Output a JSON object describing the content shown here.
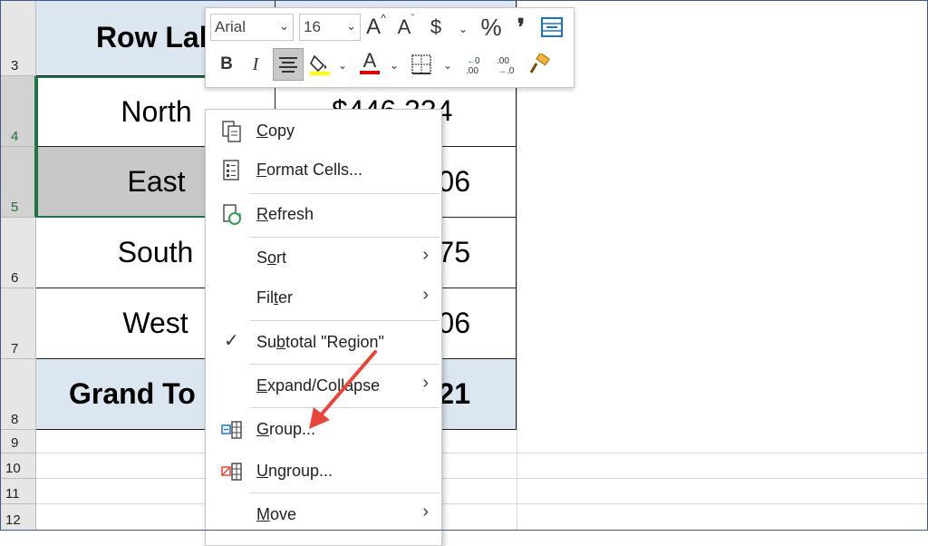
{
  "rows": [
    "3",
    "4",
    "5",
    "6",
    "7",
    "8",
    "9",
    "10",
    "11",
    "12"
  ],
  "pivot": {
    "header": {
      "label": "Row Labe",
      "value": ""
    },
    "items": [
      {
        "label": "North",
        "value": "$446,334"
      },
      {
        "label": "East",
        "value": "06"
      },
      {
        "label": "South",
        "value": "75"
      },
      {
        "label": "West",
        "value": "06"
      }
    ],
    "total": {
      "label": "Grand To",
      "value": "21"
    }
  },
  "mini_toolbar": {
    "font_name": "Arial",
    "font_size": "16",
    "grow_font": "A",
    "shrink_font": "A",
    "currency": "$",
    "percent": "%",
    "comma": "❜",
    "bold": "B",
    "italic": "I",
    "font_color": "A"
  },
  "menu": {
    "copy": {
      "u": "C",
      "rest": "opy"
    },
    "format_cells": {
      "u": "F",
      "rest": "ormat Cells..."
    },
    "refresh": {
      "u": "R",
      "rest": "efresh"
    },
    "sort": {
      "pre": "S",
      "u": "o",
      "rest": "rt"
    },
    "filter": {
      "pre": "Fil",
      "u": "t",
      "rest": "er"
    },
    "subtotal": {
      "pre": "Su",
      "u": "b",
      "rest": "total \"Region\""
    },
    "expand": {
      "u": "E",
      "rest": "xpand/Collapse"
    },
    "group": {
      "u": "G",
      "rest": "roup..."
    },
    "ungroup": {
      "u": "U",
      "rest": "ngroup..."
    },
    "move": {
      "u": "M",
      "rest": "ove"
    },
    "checkmark": "✓",
    "submenu_arrow": "›"
  },
  "colors": {
    "accent_green": "#217346",
    "arrow_red": "#e8453c",
    "header_blue": "#dce6f1"
  }
}
